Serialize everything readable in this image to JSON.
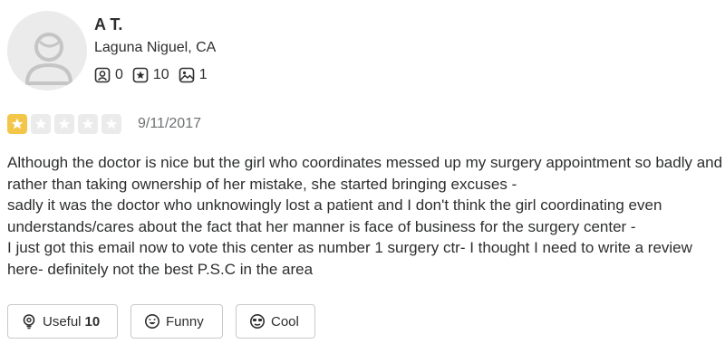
{
  "user": {
    "name": "A T.",
    "location": "Laguna Niguel, CA",
    "friends": "0",
    "reviews": "10",
    "photos": "1"
  },
  "review": {
    "rating": 1,
    "rating_max": 5,
    "date": "9/11/2017",
    "text": "Although the doctor is nice but the girl who coordinates messed up my surgery appointment so badly and rather than taking ownership of her mistake, she started bringing excuses -\nsadly it was the doctor who unknowingly lost a patient and I don't think the girl coordinating even understands/cares about the fact that her manner is face of business for the surgery center -\nI just got this email now to vote this center as number 1 surgery ctr- I thought I need to write a review here- definitely not the best P.S.C in the area"
  },
  "actions": {
    "useful_label": "Useful",
    "useful_count": "10",
    "funny_label": "Funny",
    "cool_label": "Cool"
  },
  "colors": {
    "star_on": "#f3c64a",
    "star_off": "#ebebeb",
    "text": "#2d2e2f",
    "muted": "#6e7072"
  }
}
